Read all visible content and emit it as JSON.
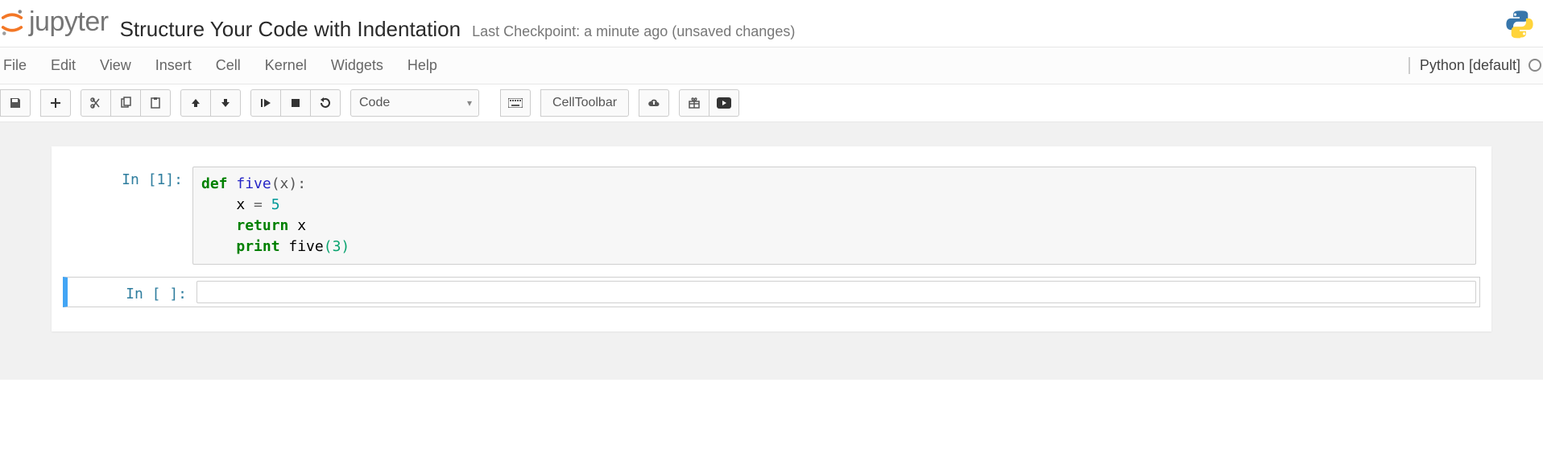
{
  "header": {
    "logo_text": "jupyter",
    "title": "Structure Your Code with Indentation",
    "checkpoint": "Last Checkpoint: a minute ago (unsaved changes)"
  },
  "menubar": {
    "items": [
      "File",
      "Edit",
      "View",
      "Insert",
      "Cell",
      "Kernel",
      "Widgets",
      "Help"
    ],
    "kernel_name": "Python [default]"
  },
  "toolbar": {
    "cell_type": "Code",
    "celltoolbar_label": "CellToolbar"
  },
  "cells": [
    {
      "prompt": "In [1]:",
      "tokens": [
        {
          "t": "def ",
          "c": "tok-kw"
        },
        {
          "t": "five",
          "c": "tok-call"
        },
        {
          "t": "(x):",
          "c": "tok-paren"
        },
        {
          "t": "\n",
          "c": ""
        },
        {
          "t": "    x ",
          "c": "tok-name"
        },
        {
          "t": "= ",
          "c": "tok-op"
        },
        {
          "t": "5",
          "c": "tok-num"
        },
        {
          "t": "\n",
          "c": ""
        },
        {
          "t": "    ",
          "c": ""
        },
        {
          "t": "return",
          "c": "tok-kw"
        },
        {
          "t": " x",
          "c": "tok-name"
        },
        {
          "t": "\n",
          "c": ""
        },
        {
          "t": "    ",
          "c": ""
        },
        {
          "t": "print",
          "c": "tok-kw"
        },
        {
          "t": " five",
          "c": "tok-name"
        },
        {
          "t": "(",
          "c": "tok-arg"
        },
        {
          "t": "3",
          "c": "tok-arg"
        },
        {
          "t": ")",
          "c": "tok-arg"
        }
      ],
      "selected": false
    },
    {
      "prompt": "In [ ]:",
      "tokens": [],
      "selected": true
    }
  ]
}
